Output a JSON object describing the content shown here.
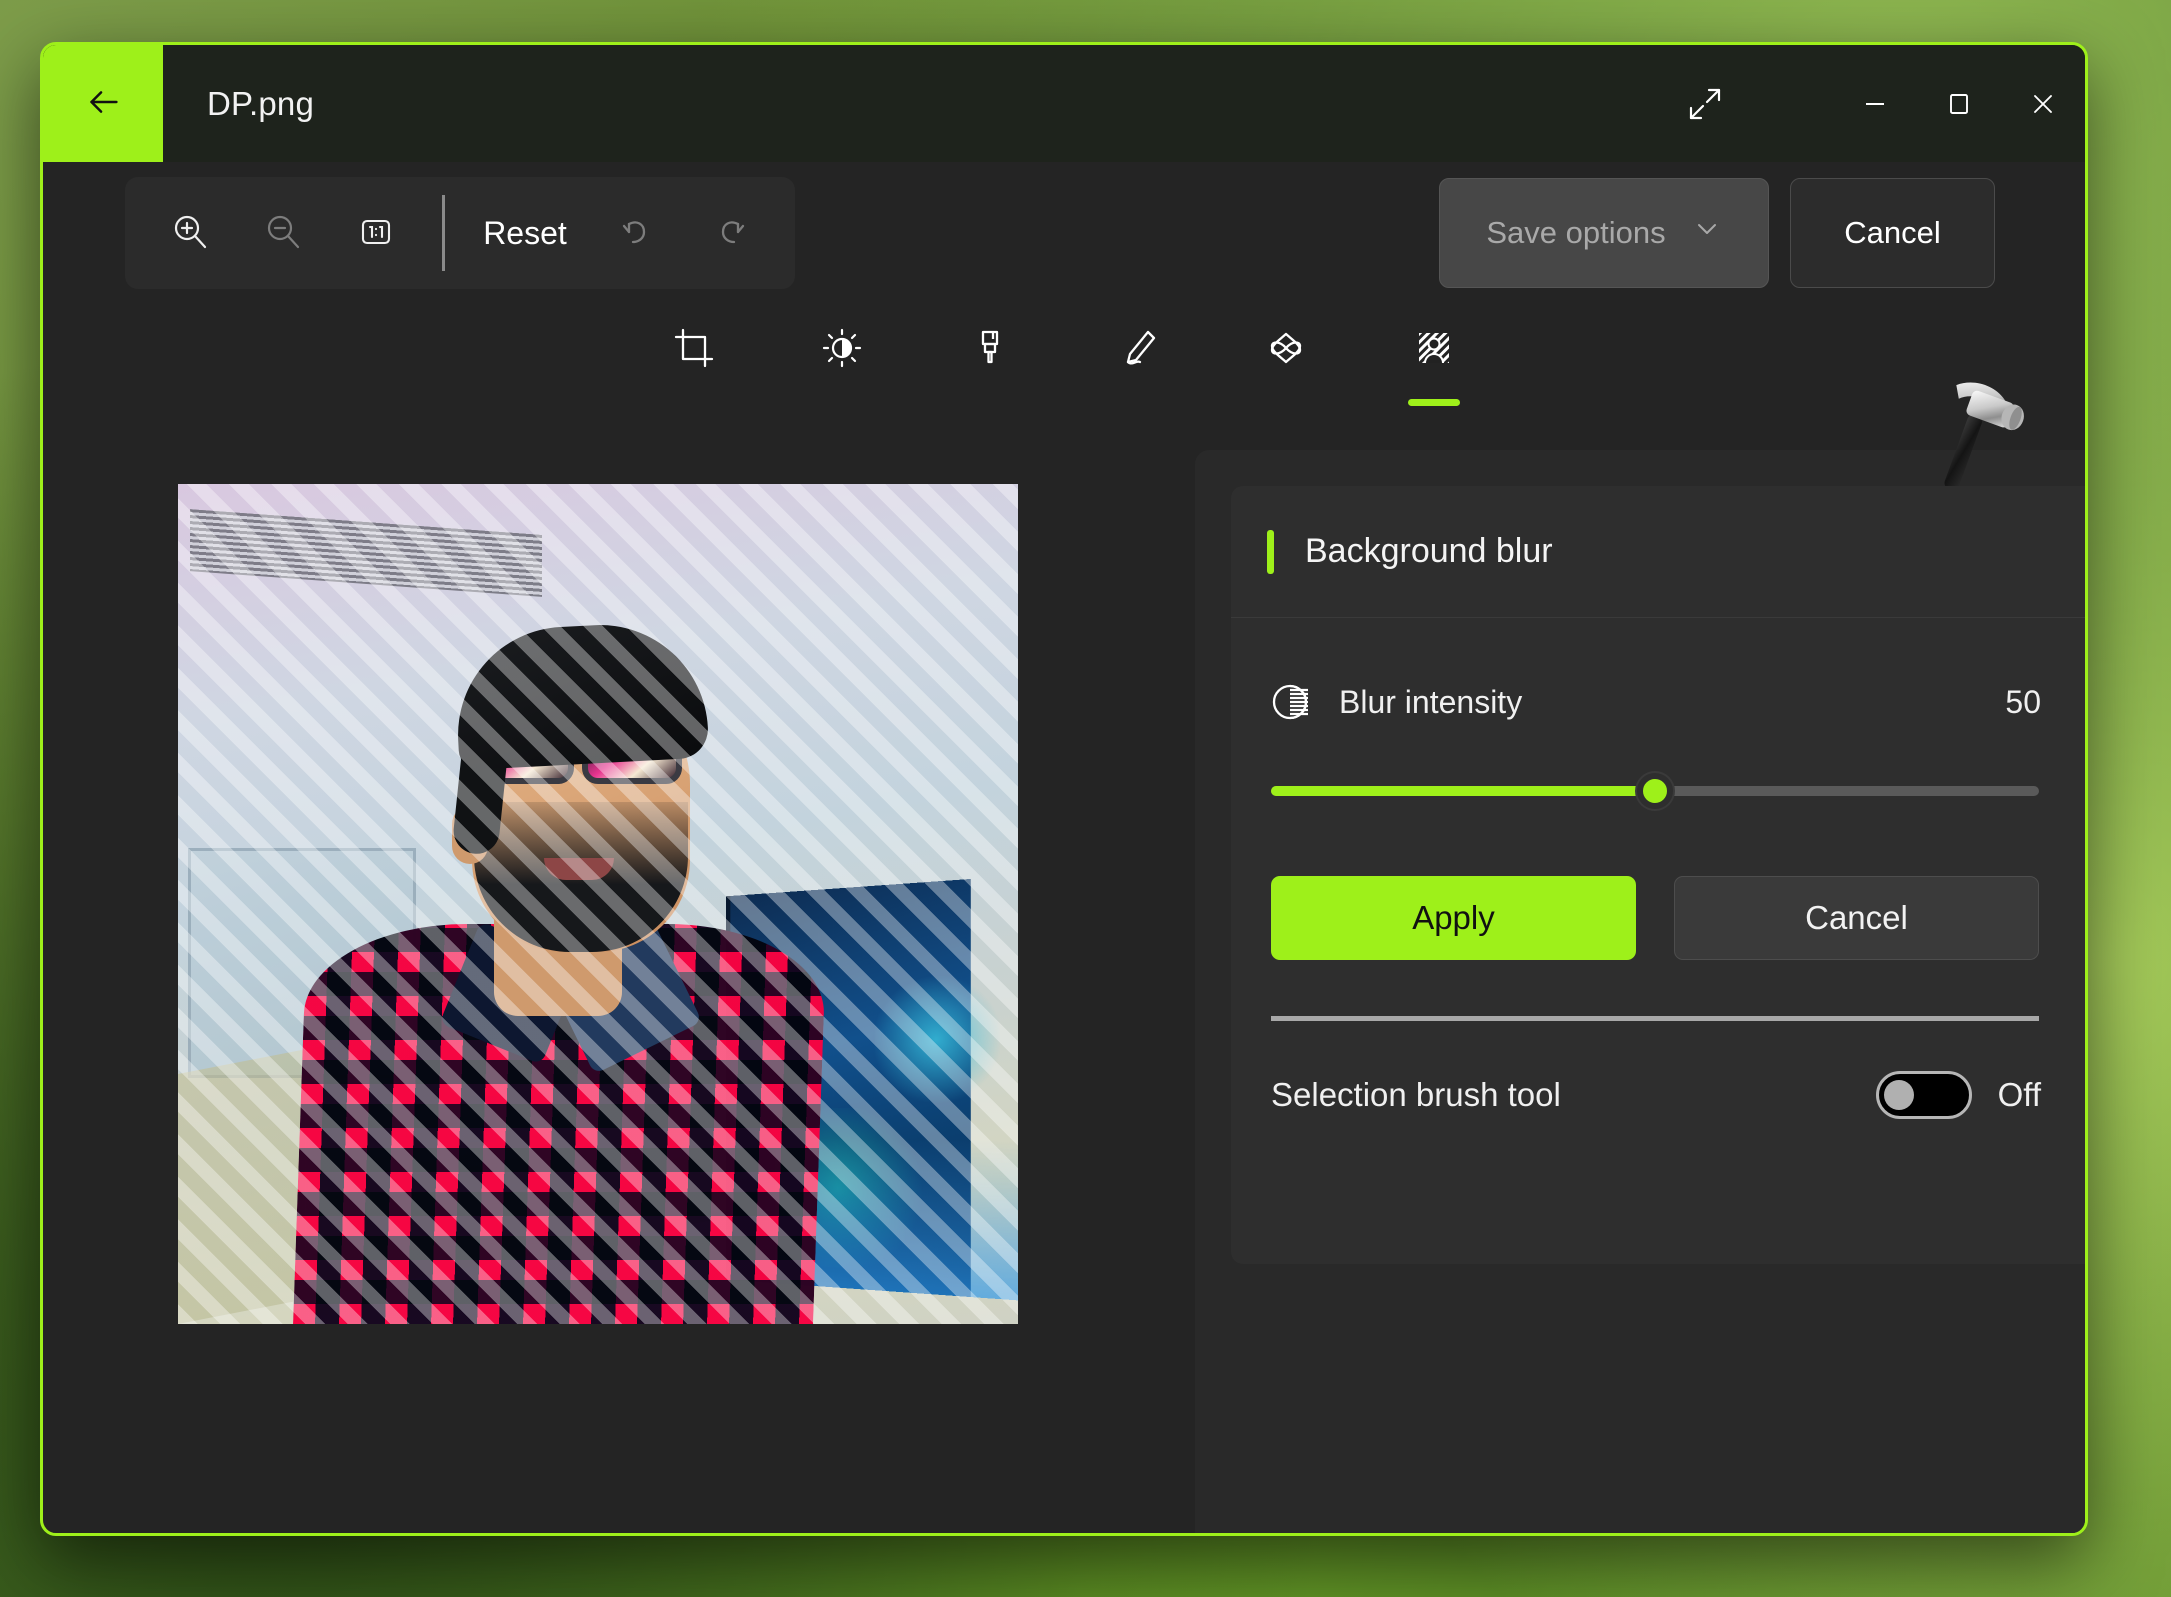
{
  "window": {
    "title": "DP.png",
    "back_icon": "arrow-left-icon",
    "accent_color": "#9ef01a",
    "controls": [
      {
        "name": "expand-icon",
        "label": "Expand"
      },
      {
        "name": "minimize-icon",
        "label": "Minimize"
      },
      {
        "name": "maximize-icon",
        "label": "Maximize"
      },
      {
        "name": "close-icon",
        "label": "Close"
      }
    ]
  },
  "toolbar": {
    "zoom_in_icon": "zoom-in-icon",
    "zoom_out_icon": "zoom-out-icon",
    "actual_size_label": "1:1",
    "reset_label": "Reset",
    "undo_icon": "undo-icon",
    "redo_icon": "redo-icon",
    "save_options_label": "Save options",
    "save_options_chevron": "chevron-down-icon",
    "cancel_label": "Cancel"
  },
  "tools": [
    {
      "name": "crop-tool",
      "label": "Crop",
      "active": false
    },
    {
      "name": "adjust-tool",
      "label": "Adjustments",
      "active": false
    },
    {
      "name": "brush-tool",
      "label": "Paint brush",
      "active": false
    },
    {
      "name": "pen-tool",
      "label": "Pen",
      "active": false
    },
    {
      "name": "erase-tool",
      "label": "Erase",
      "active": false
    },
    {
      "name": "background-blur-tool",
      "label": "Background blur",
      "active": true
    }
  ],
  "panel": {
    "header": "Background blur",
    "intensity": {
      "icon": "blur-intensity-icon",
      "label": "Blur intensity",
      "value": "50",
      "percent": 50
    },
    "apply_label": "Apply",
    "cancel_label": "Cancel",
    "brush": {
      "label": "Selection brush tool",
      "state": "Off",
      "on": false
    }
  },
  "canvas": {
    "image_name": "DP.png",
    "overlay": "diagonal-stripe-selection"
  },
  "cursor": {
    "icon": "hammer-icon"
  }
}
